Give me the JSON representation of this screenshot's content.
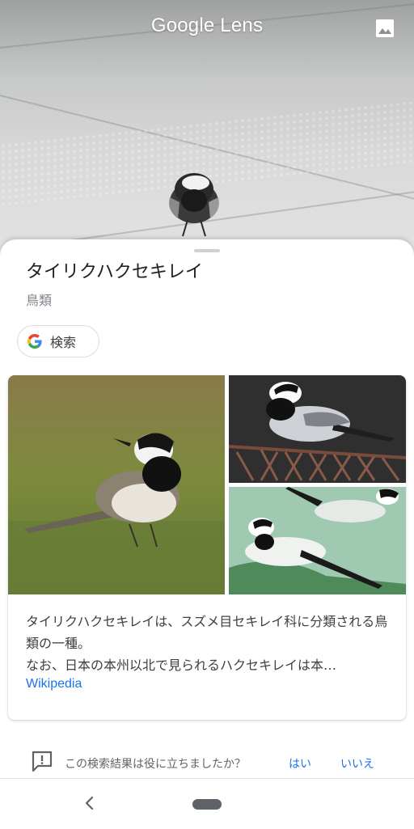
{
  "app": {
    "title": "Google Lens"
  },
  "result": {
    "title": "タイリクハクセキレイ",
    "subtitle": "鳥類",
    "search_label": "検索",
    "description": "タイリクハクセキレイは、スズメ目セキレイ科に分類される鳥類の一種。\nなお、日本の本州以北で見られるハクセキレイは本…",
    "source": "Wikipedia"
  },
  "feedback": {
    "question": "この検索結果は役に立ちましたか？",
    "yes": "はい",
    "no": "いいえ"
  },
  "icons": {
    "gallery": "image-icon",
    "search": "google-g-icon",
    "feedback": "feedback-icon",
    "back": "back-icon",
    "home": "home-pill"
  },
  "colors": {
    "link": "#1a73e8",
    "google_blue": "#4285F4",
    "google_red": "#EA4335",
    "google_yellow": "#FBBC05",
    "google_green": "#34A853"
  }
}
